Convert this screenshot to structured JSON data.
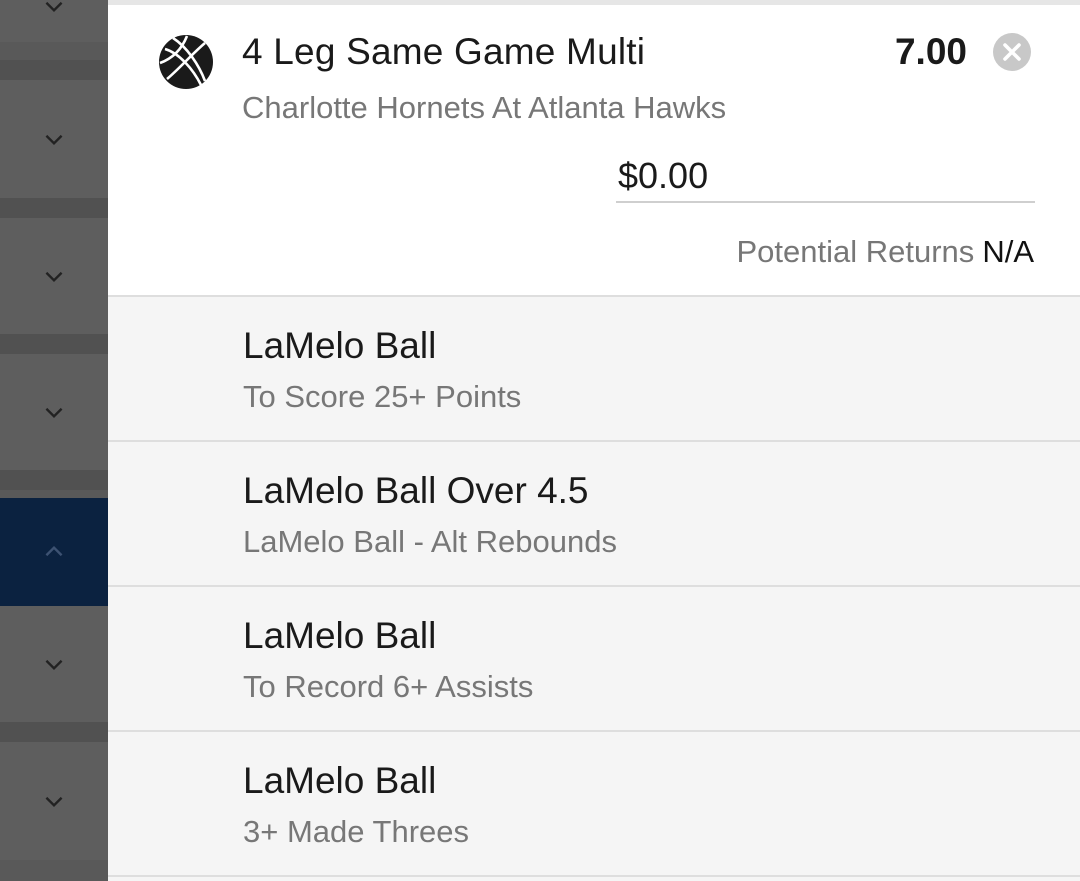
{
  "colors": {
    "overlay": "#5c5c5c",
    "active_rail": "#0b2240",
    "panel": "#ffffff",
    "leg_background": "#f5f5f5",
    "primary_text": "#1a1a1a",
    "secondary_text": "#777777"
  },
  "rail": {
    "toggles": [
      {
        "icon": "chevron-down-icon",
        "state": "collapsed"
      },
      {
        "icon": "chevron-down-icon",
        "state": "collapsed"
      },
      {
        "icon": "chevron-down-icon",
        "state": "collapsed"
      },
      {
        "icon": "chevron-down-icon",
        "state": "collapsed"
      },
      {
        "icon": "chevron-up-icon",
        "state": "expanded"
      },
      {
        "icon": "chevron-down-icon",
        "state": "collapsed"
      },
      {
        "icon": "chevron-down-icon",
        "state": "collapsed"
      }
    ]
  },
  "bet": {
    "icon": "basketball-icon",
    "title": "4 Leg Same Game Multi",
    "odds": "7.00",
    "remove_icon": "close-circle-icon",
    "event": "Charlotte Hornets At Atlanta Hawks",
    "stake_value": "$0.00",
    "potential_returns_label": "Potential Returns",
    "potential_returns_value": "N/A"
  },
  "legs": [
    {
      "title": "LaMelo Ball",
      "market": "To Score 25+ Points"
    },
    {
      "title": "LaMelo Ball Over 4.5",
      "market": "LaMelo Ball - Alt Rebounds"
    },
    {
      "title": "LaMelo Ball",
      "market": "To Record 6+ Assists"
    },
    {
      "title": "LaMelo Ball",
      "market": "3+ Made Threes"
    }
  ]
}
